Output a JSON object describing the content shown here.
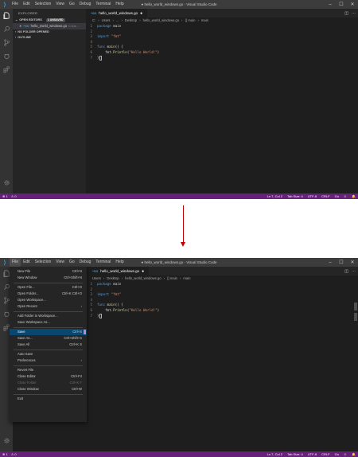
{
  "app": {
    "window_title": "● hello_world_windows.go - Visual Studio Code",
    "logo": "vscode-logo-icon",
    "menu": [
      "File",
      "Edit",
      "Selection",
      "View",
      "Go",
      "Debug",
      "Terminal",
      "Help"
    ],
    "window_controls": [
      "minimize-icon",
      "maximize-icon",
      "close-icon"
    ]
  },
  "sidebar": {
    "title": "EXPLORER",
    "open_editors": {
      "label": "OPEN EDITORS",
      "badge": "1 UNSAVED"
    },
    "open_file": {
      "name": "hello_world_windows.go",
      "path": "C:\\Us..."
    },
    "no_folder": "NO FOLDER OPENED",
    "outline": "OUTLINE"
  },
  "editor": {
    "tab_label": "hello_world_windows.go",
    "breadcrumb": [
      "C:",
      "Users",
      "...",
      "Desktop",
      "hello_world_windows.go",
      "{} main",
      "main"
    ],
    "code": [
      {
        "n": "1",
        "tokens": [
          [
            "kw",
            "package"
          ],
          [
            "plain",
            " main"
          ]
        ]
      },
      {
        "n": "2",
        "tokens": []
      },
      {
        "n": "3",
        "tokens": [
          [
            "kw",
            "import"
          ],
          [
            "plain",
            " "
          ],
          [
            "str",
            "\"fmt\""
          ]
        ]
      },
      {
        "n": "4",
        "tokens": []
      },
      {
        "n": "5",
        "tokens": [
          [
            "kw",
            "func"
          ],
          [
            "plain",
            " "
          ],
          [
            "fn",
            "main"
          ],
          [
            "plain",
            "() {"
          ]
        ]
      },
      {
        "n": "6",
        "tokens": [
          [
            "plain",
            "    fmt."
          ],
          [
            "fn",
            "Println"
          ],
          [
            "plain",
            "("
          ],
          [
            "str",
            "\"Hello World!\""
          ],
          [
            "plain",
            ")"
          ]
        ]
      },
      {
        "n": "7",
        "tokens": [
          [
            "plain",
            "}"
          ]
        ]
      }
    ]
  },
  "status": {
    "left": [
      "⊗ 1",
      "⚠ 0"
    ],
    "right": [
      "Ln 7, Col 2",
      "Tab Size: 4",
      "UTF-8",
      "CRLF",
      "Go",
      "☺",
      "🔔"
    ]
  },
  "file_menu": [
    {
      "label": "New File",
      "shortcut": "Ctrl+N"
    },
    {
      "label": "New Window",
      "shortcut": "Ctrl+Shift+N"
    },
    {
      "sep": true
    },
    {
      "label": "Open File...",
      "shortcut": "Ctrl+O"
    },
    {
      "label": "Open Folder...",
      "shortcut": "Ctrl+K Ctrl+O"
    },
    {
      "label": "Open Workspace...",
      "shortcut": ""
    },
    {
      "label": "Open Recent",
      "shortcut": "",
      "submenu": true
    },
    {
      "sep": true
    },
    {
      "label": "Add Folder to Workspace...",
      "shortcut": ""
    },
    {
      "label": "Save Workspace As...",
      "shortcut": ""
    },
    {
      "sep": true
    },
    {
      "label": "Save",
      "shortcut": "Ctrl+S",
      "selected": true
    },
    {
      "label": "Save As...",
      "shortcut": "Ctrl+Shift+S"
    },
    {
      "label": "Save All",
      "shortcut": "Ctrl+K S"
    },
    {
      "sep": true
    },
    {
      "label": "Auto Save",
      "shortcut": ""
    },
    {
      "label": "Preferences",
      "shortcut": "",
      "submenu": true
    },
    {
      "sep": true
    },
    {
      "label": "Revert File",
      "shortcut": ""
    },
    {
      "label": "Close Editor",
      "shortcut": "Ctrl+F4"
    },
    {
      "label": "Close Folder",
      "shortcut": "Ctrl+K F",
      "disabled": true
    },
    {
      "label": "Close Window",
      "shortcut": "Ctrl+W"
    },
    {
      "sep": true
    },
    {
      "label": "Exit",
      "shortcut": ""
    }
  ],
  "colors": {
    "statusbar": "#68217a",
    "arrow": "#c00000",
    "selection": "#094771"
  }
}
